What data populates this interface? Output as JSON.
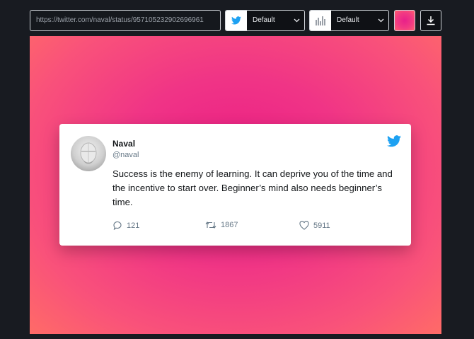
{
  "toolbar": {
    "url_value": "https://twitter.com/naval/status/957105232902696961",
    "theme_select": {
      "icon": "twitter-bird-icon",
      "selected": "Default"
    },
    "layout_select": {
      "icon": "bar-chart-icon",
      "selected": "Default"
    },
    "background_color": "#ea1c84",
    "download_icon": "download-icon"
  },
  "tweet": {
    "name": "Naval",
    "handle": "@naval",
    "text": "Success is the enemy of learning. It can deprive you of the time and the incentive to start over. Beginner’s mind also needs beginner’s time.",
    "replies": "121",
    "retweets": "1867",
    "likes": "5911"
  },
  "colors": {
    "twitter_blue": "#1da1f2",
    "gradient_center": "#ea1c84",
    "gradient_edge": "#ff6b67"
  }
}
